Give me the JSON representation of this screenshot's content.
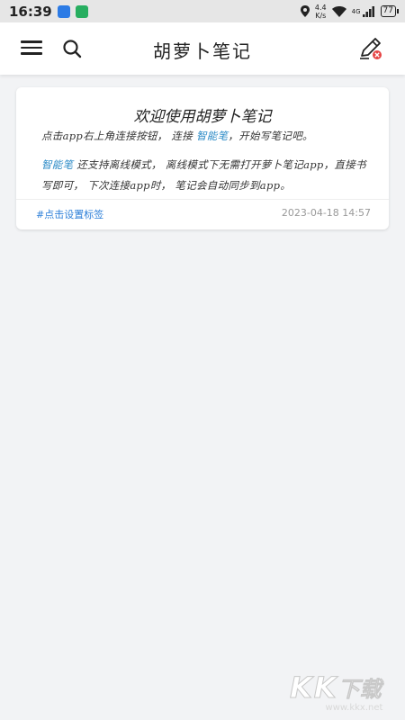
{
  "status_bar": {
    "time": "16:39",
    "left_icons": [
      "app-notification-icon",
      "app-notification-icon"
    ],
    "speed_top": "4.4",
    "speed_unit": "K/s",
    "signal_label": "4G",
    "battery": "77"
  },
  "header": {
    "title": "胡萝卜笔记",
    "menu_icon": "hamburger-menu-icon",
    "search_icon": "search-icon",
    "pen_icon": "pen-disconnected-icon"
  },
  "note": {
    "title": "欢迎使用胡萝卜笔记",
    "p1_a": "点击app右上角连接按钮，  连接 ",
    "p1_hl": "智能笔",
    "p1_b": "，开始写笔记吧。",
    "p2_hl": "智能笔",
    "p2_a": " 还支持离线模式，  离线模式下无需打开萝卜笔记app，直接书写即可，  下次连接app时，  笔记会自动同步到app。",
    "tag": "#点击设置标签",
    "date": "2023-04-18 14:57"
  },
  "watermark": {
    "logo_k1": "K",
    "logo_k2": "K",
    "logo_cn": "下载",
    "url": "www.kkx.net"
  },
  "colors": {
    "accent": "#2d7fd8",
    "highlight": "#2a8ac6",
    "background": "#f2f3f5"
  }
}
